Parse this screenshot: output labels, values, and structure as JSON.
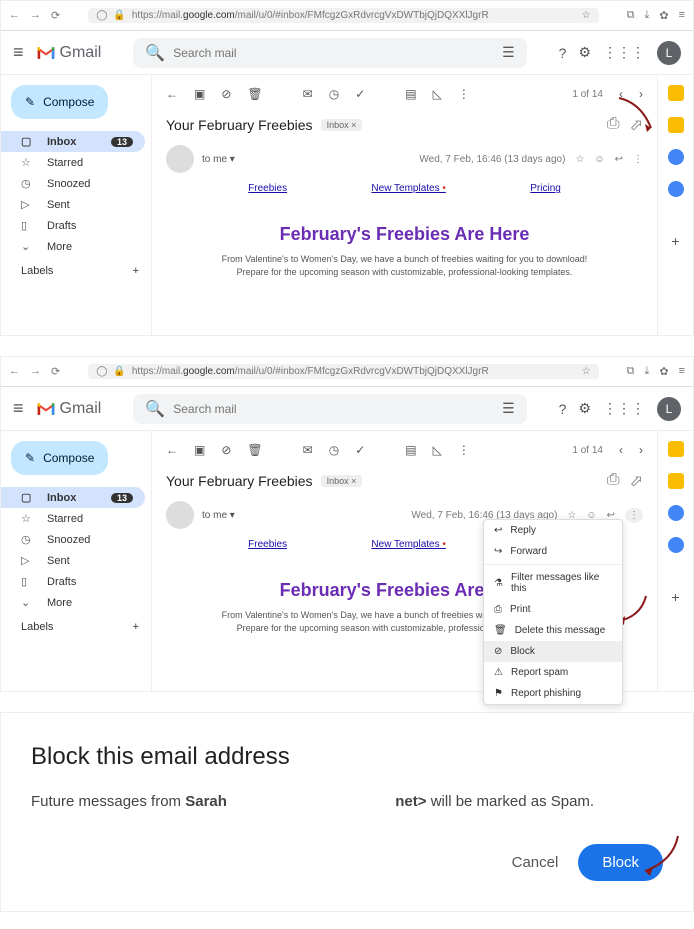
{
  "browser": {
    "url_prefix": "https://mail.",
    "url_domain": "google.com",
    "url_path": "/mail/u/0/#inbox/FMfcgzGxRdvrcgVxDWTbjQjDQXXlJgrR"
  },
  "header": {
    "app_name": "Gmail",
    "search_placeholder": "Search mail",
    "avatar_initial": "L"
  },
  "sidebar": {
    "compose": "Compose",
    "items": [
      {
        "icon": "inbox",
        "label": "Inbox",
        "badge": "13",
        "active": true
      },
      {
        "icon": "star",
        "label": "Starred"
      },
      {
        "icon": "clock",
        "label": "Snoozed"
      },
      {
        "icon": "send",
        "label": "Sent"
      },
      {
        "icon": "draft",
        "label": "Drafts"
      },
      {
        "icon": "more",
        "label": "More"
      }
    ],
    "labels_header": "Labels"
  },
  "toolbar": {
    "counter": "1 of 14"
  },
  "mail": {
    "subject": "Your February Freebies",
    "chip": "Inbox ×",
    "to": "to me",
    "date": "Wed, 7 Feb, 16:46 (13 days ago)",
    "links": {
      "freebies": "Freebies",
      "templates": "New Templates",
      "pricing": "Pricing"
    },
    "hero_title": "February's Freebies Are Here",
    "desc_1": "From Valentine's to Women's Day, we have a bunch of freebies waiting for you to download!",
    "desc_2": "Prepare for the upcoming season with customizable, professional-looking templates."
  },
  "context_menu": {
    "reply": "Reply",
    "forward": "Forward",
    "filter": "Filter messages like this",
    "print": "Print",
    "delete": "Delete this message",
    "block": "Block",
    "spam": "Report spam",
    "phishing": "Report phishing"
  },
  "dialog": {
    "title": "Block this email address",
    "body_prefix": "Future messages from ",
    "sender": "Sarah",
    "body_mid": "net>",
    "body_suffix": " will be marked as Spam.",
    "cancel": "Cancel",
    "block": "Block"
  }
}
